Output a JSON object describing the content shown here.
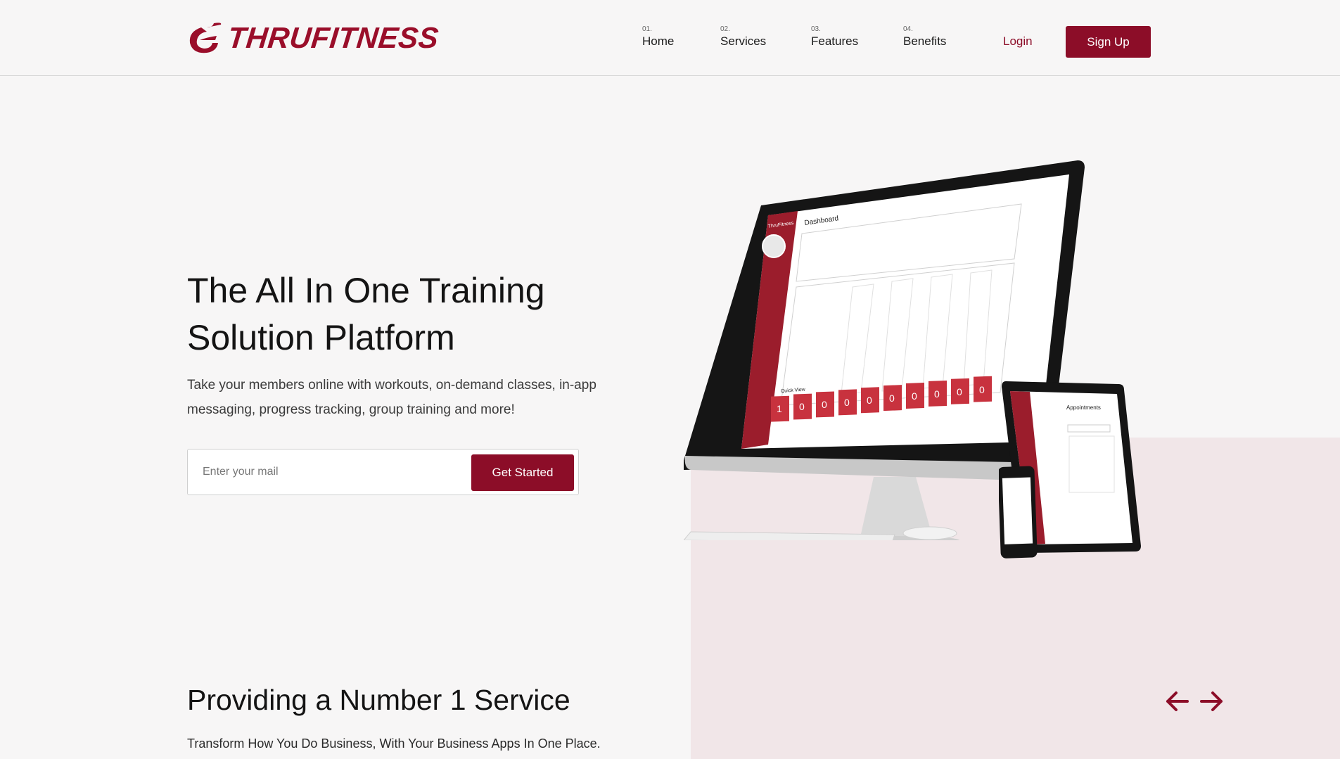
{
  "brand": {
    "name": "THRUFITNESS",
    "color": "#8c0d28"
  },
  "nav": [
    {
      "num": "01.",
      "label": "Home"
    },
    {
      "num": "02.",
      "label": "Services"
    },
    {
      "num": "03.",
      "label": "Features"
    },
    {
      "num": "04.",
      "label": "Benefits"
    }
  ],
  "header": {
    "login_label": "Login",
    "signup_label": "Sign Up"
  },
  "hero": {
    "title_line1": "The All In One Training",
    "title_line2": "Solution Platform",
    "subtitle": "Take your members online with workouts, on-demand classes, in-app messaging, progress tracking, group training and more!",
    "email_placeholder": "Enter your mail",
    "cta_label": "Get Started"
  },
  "section": {
    "title": "Providing a Number 1 Service",
    "subtitle": "Transform How You Do Business, With Your Business Apps In One Place."
  },
  "mockup": {
    "sidebar_title": "ThruFitness",
    "dashboard_title": "Dashboard",
    "quick_view_label": "Quick View",
    "quick_view_values": [
      "1",
      "0",
      "0",
      "0",
      "0",
      "0",
      "0",
      "0",
      "0",
      "0"
    ],
    "tablet_title": "Appointments"
  },
  "icons": {
    "prev": "arrow-left-icon",
    "next": "arrow-right-icon"
  }
}
